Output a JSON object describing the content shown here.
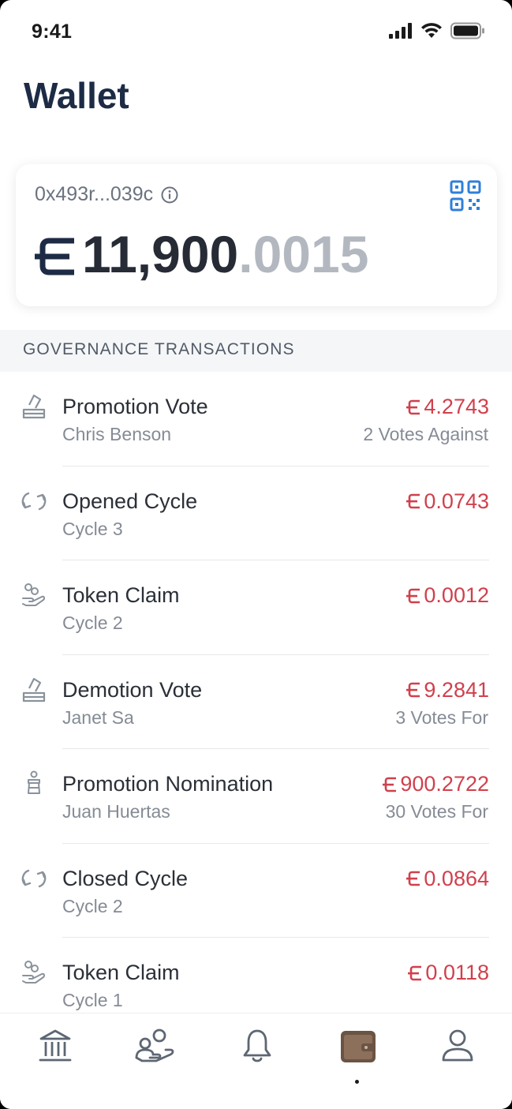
{
  "status_bar": {
    "time": "9:41"
  },
  "page": {
    "title": "Wallet"
  },
  "wallet": {
    "address": "0x493r...039c",
    "balance_integer": "11,900",
    "balance_decimal": ".0015"
  },
  "section": {
    "title": "GOVERNANCE TRANSACTIONS"
  },
  "transactions": [
    {
      "icon": "ballot-icon",
      "title": "Promotion Vote",
      "subtitle": "Chris Benson",
      "amount": "4.2743",
      "detail": "2 Votes Against"
    },
    {
      "icon": "cycle-icon",
      "title": "Opened Cycle",
      "subtitle": "Cycle 3",
      "amount": "0.0743",
      "detail": ""
    },
    {
      "icon": "token-hand-icon",
      "title": "Token Claim",
      "subtitle": "Cycle 2",
      "amount": "0.0012",
      "detail": ""
    },
    {
      "icon": "ballot-icon",
      "title": "Demotion Vote",
      "subtitle": "Janet Sa",
      "amount": "9.2841",
      "detail": "3 Votes For"
    },
    {
      "icon": "nomination-icon",
      "title": "Promotion Nomination",
      "subtitle": "Juan Huertas",
      "amount": "900.2722",
      "detail": "30 Votes For"
    },
    {
      "icon": "cycle-icon",
      "title": "Closed Cycle",
      "subtitle": "Cycle 2",
      "amount": "0.0864",
      "detail": ""
    },
    {
      "icon": "token-hand-icon",
      "title": "Token Claim",
      "subtitle": "Cycle 1",
      "amount": "0.0118",
      "detail": ""
    }
  ],
  "tab_bar": {
    "items": [
      {
        "icon": "bank-icon",
        "active": false
      },
      {
        "icon": "community-icon",
        "active": false
      },
      {
        "icon": "bell-icon",
        "active": false
      },
      {
        "icon": "wallet-icon",
        "active": true
      },
      {
        "icon": "profile-icon",
        "active": false
      }
    ]
  },
  "colors": {
    "title": "#1d2b45",
    "negative_amount": "#d0404c",
    "qr_accent": "#2f7fd9",
    "active_tab": "#6b5444",
    "inactive_tab": "#5d6673"
  }
}
